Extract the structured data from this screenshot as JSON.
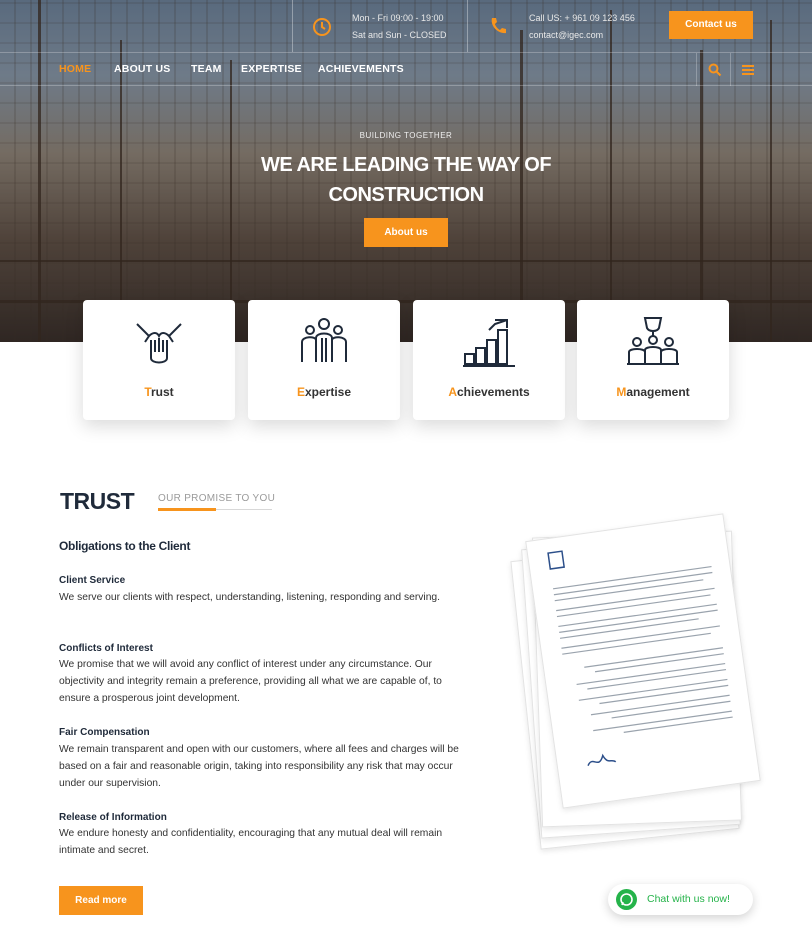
{
  "header": {
    "hours": {
      "line1": "Mon - Fri 09:00 - 19:00",
      "line2": "Sat and Sun - CLOSED"
    },
    "contact": {
      "line1": "Call US: + 961 09 123 456",
      "line2": "contact@igec.com"
    },
    "contact_button": "Contact us"
  },
  "nav": {
    "items": [
      "HOME",
      "ABOUT US",
      "TEAM",
      "EXPERTISE",
      "ACHIEVEMENTS"
    ],
    "active": "HOME",
    "tools": [
      "search-icon",
      "menu-icon"
    ]
  },
  "hero": {
    "kicker": "BUILDING TOGETHER",
    "title_line1": "WE ARE LEADING THE WAY OF",
    "title_line2": "CONSTRUCTION",
    "button": "About us"
  },
  "features": [
    {
      "first": "T",
      "rest": "rust",
      "icon": "handshake-icon"
    },
    {
      "first": "E",
      "rest": "xpertise",
      "icon": "team-icon"
    },
    {
      "first": "A",
      "rest": "chievements",
      "icon": "growth-chart-icon"
    },
    {
      "first": "M",
      "rest": "anagement",
      "icon": "trophy-leader-icon"
    }
  ],
  "trust": {
    "heading": "TRUST",
    "subheading": "OUR PROMISE TO YOU",
    "section_title": "Obligations to the Client",
    "blocks": [
      {
        "title": "Client Service",
        "text": "We serve our clients with respect, understanding, listening, responding and serving."
      },
      {
        "title": "Conflicts of Interest",
        "text": "We promise that we will avoid any conflict of interest under any circumstance. Our objectivity and integrity remain a preference, providing all what we are capable of, to ensure a prosperous joint development."
      },
      {
        "title": "Fair Compensation",
        "text": "We remain transparent and open with our customers, where all fees and charges will be based on a fair and reasonable origin, taking into responsibility any risk that may occur under our supervision."
      },
      {
        "title": "Release of Information",
        "text": "We endure honesty and confidentiality, encouraging that any mutual deal will remain intimate and secret."
      }
    ],
    "read_more": "Read more"
  },
  "chat": {
    "label": "Chat with us now!"
  },
  "colors": {
    "accent": "#f7941d",
    "dark": "#1f2a3a",
    "chat": "#25b34a"
  }
}
